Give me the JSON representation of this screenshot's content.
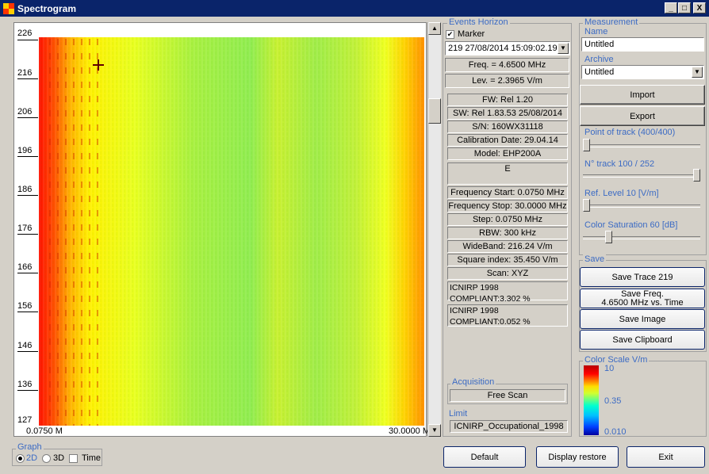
{
  "window": {
    "title": "Spectrogram",
    "min": "_",
    "max": "□",
    "close": "X"
  },
  "plot": {
    "y_ticks": [
      "226",
      "216",
      "206",
      "196",
      "186",
      "176",
      "166",
      "156",
      "146",
      "136",
      "127"
    ],
    "x_start": "0.0750 M",
    "x_end": "30.0000 M",
    "marker_symbol": "+"
  },
  "events": {
    "group_label": "Events Horizon",
    "marker_label": "Marker",
    "marker_checked": true,
    "selected_event": "219  27/08/2014 15:09:02.19",
    "freq": "Freq. = 4.6500 MHz",
    "level": "Lev. = 2.3965 V/m",
    "info": [
      "FW: Rel 1.20",
      "SW: Rel 1.83.53 25/08/2014",
      "S/N: 160WX31118",
      "Calibration Date: 29.04.14",
      "Model: EHP200A"
    ],
    "e_label": "E",
    "params": [
      "Frequency Start: 0.0750 MHz",
      "Frequency Stop: 30.0000 MHz",
      "Step: 0.0750 MHz",
      "RBW: 300 kHz",
      "WideBand: 216.24 V/m",
      "Square index: 35.450 V/m",
      "Scan: XYZ"
    ],
    "icnirp_1": "ICNIRP 1998 COMPLIANT:3.302 %",
    "icnirp_2": "ICNIRP 1998 COMPLIANT:0.052 %",
    "acquisition_label": "Acquisition",
    "acquisition_value": "Free Scan",
    "limit_label": "Limit",
    "limit_value": "ICNIRP_Occupational_1998"
  },
  "measurement": {
    "group_label": "Measurement",
    "name_label": "Name",
    "name_value": "Untitled",
    "archive_label": "Archive",
    "archive_value": "Untitled",
    "import_label": "Import",
    "export_label": "Export",
    "point_of_track": "Point of track (400/400)",
    "point_of_track_level": 0.0,
    "n_track": "N° track 100 / 252",
    "n_track_level": 1.0,
    "ref_level": "Ref. Level 10 [V/m]",
    "ref_level_level": 0.0,
    "color_saturation": "Color Saturation 60 [dB]",
    "color_saturation_level": 0.2
  },
  "save": {
    "group_label": "Save",
    "trace_label": "Save Trace 219",
    "freq_line1": "Save Freq.",
    "freq_line2": "4.6500 MHz vs. Time",
    "image_label": "Save Image",
    "clipboard_label": "Save Clipboard"
  },
  "color_scale": {
    "label": "Color Scale V/m",
    "top": "10",
    "mid": "0.35",
    "bottom": "0.010"
  },
  "graph": {
    "label": "Graph",
    "opt_2d": "2D",
    "opt_3d": "3D",
    "opt_time": "Time",
    "selected": "2D"
  },
  "bottom_buttons": {
    "default": "Default",
    "display_restore": "Display restore",
    "exit": "Exit"
  }
}
